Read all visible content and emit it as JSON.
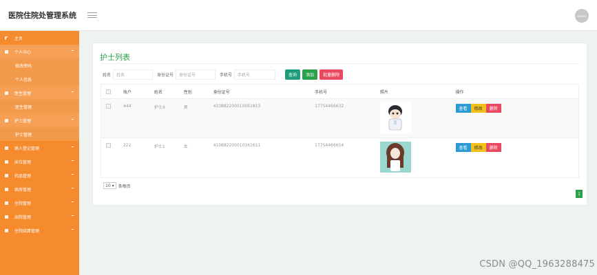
{
  "app": {
    "title": "医院住院处管理系统",
    "avatar_text": "avatar"
  },
  "sidebar": {
    "items": [
      {
        "label": "主页"
      },
      {
        "label": "个人中心"
      },
      {
        "label": "修改密码"
      },
      {
        "label": "个人信息"
      },
      {
        "label": "医生管理"
      },
      {
        "label": "医生管理"
      },
      {
        "label": "护士管理"
      },
      {
        "label": "护士管理"
      },
      {
        "label": "病人登记管理"
      },
      {
        "label": "床位管理"
      },
      {
        "label": "药品管理"
      },
      {
        "label": "病房管理"
      },
      {
        "label": "住院管理"
      },
      {
        "label": "出院管理"
      },
      {
        "label": "住院结算管理"
      }
    ]
  },
  "page": {
    "title": "护士列表",
    "search": {
      "name_label": "姓名",
      "name_placeholder": "姓名",
      "id_label": "身份证号",
      "id_placeholder": "身份证号",
      "phone_label": "手机号",
      "phone_placeholder": "手机号",
      "search_btn": "查询",
      "add_btn": "添加",
      "batch_delete_btn": "批量删除"
    },
    "table": {
      "headers": [
        "账户",
        "姓名",
        "性别",
        "身份证号",
        "手机号",
        "照片",
        "操作"
      ],
      "rows": [
        {
          "account": "444",
          "name": "护士4",
          "gender": "男",
          "id_no": "410882200010061813",
          "phone": "17754466632"
        },
        {
          "account": "222",
          "name": "护士1",
          "gender": "女",
          "id_no": "410882200010161611",
          "phone": "17754466654"
        }
      ],
      "actions": {
        "view": "查看",
        "edit": "修改",
        "delete": "删除"
      }
    },
    "pager": {
      "page_size": "10",
      "per_page_label": "条每页",
      "current_page": "1"
    }
  },
  "watermark": "CSDN @QQ_1963288475",
  "colors": {
    "sidebar": "#f58b2c",
    "accent_green": "#2aa14a",
    "delete_red": "#e9495f",
    "view_blue": "#2c9ad5",
    "edit_yellow": "#f2c01b"
  }
}
